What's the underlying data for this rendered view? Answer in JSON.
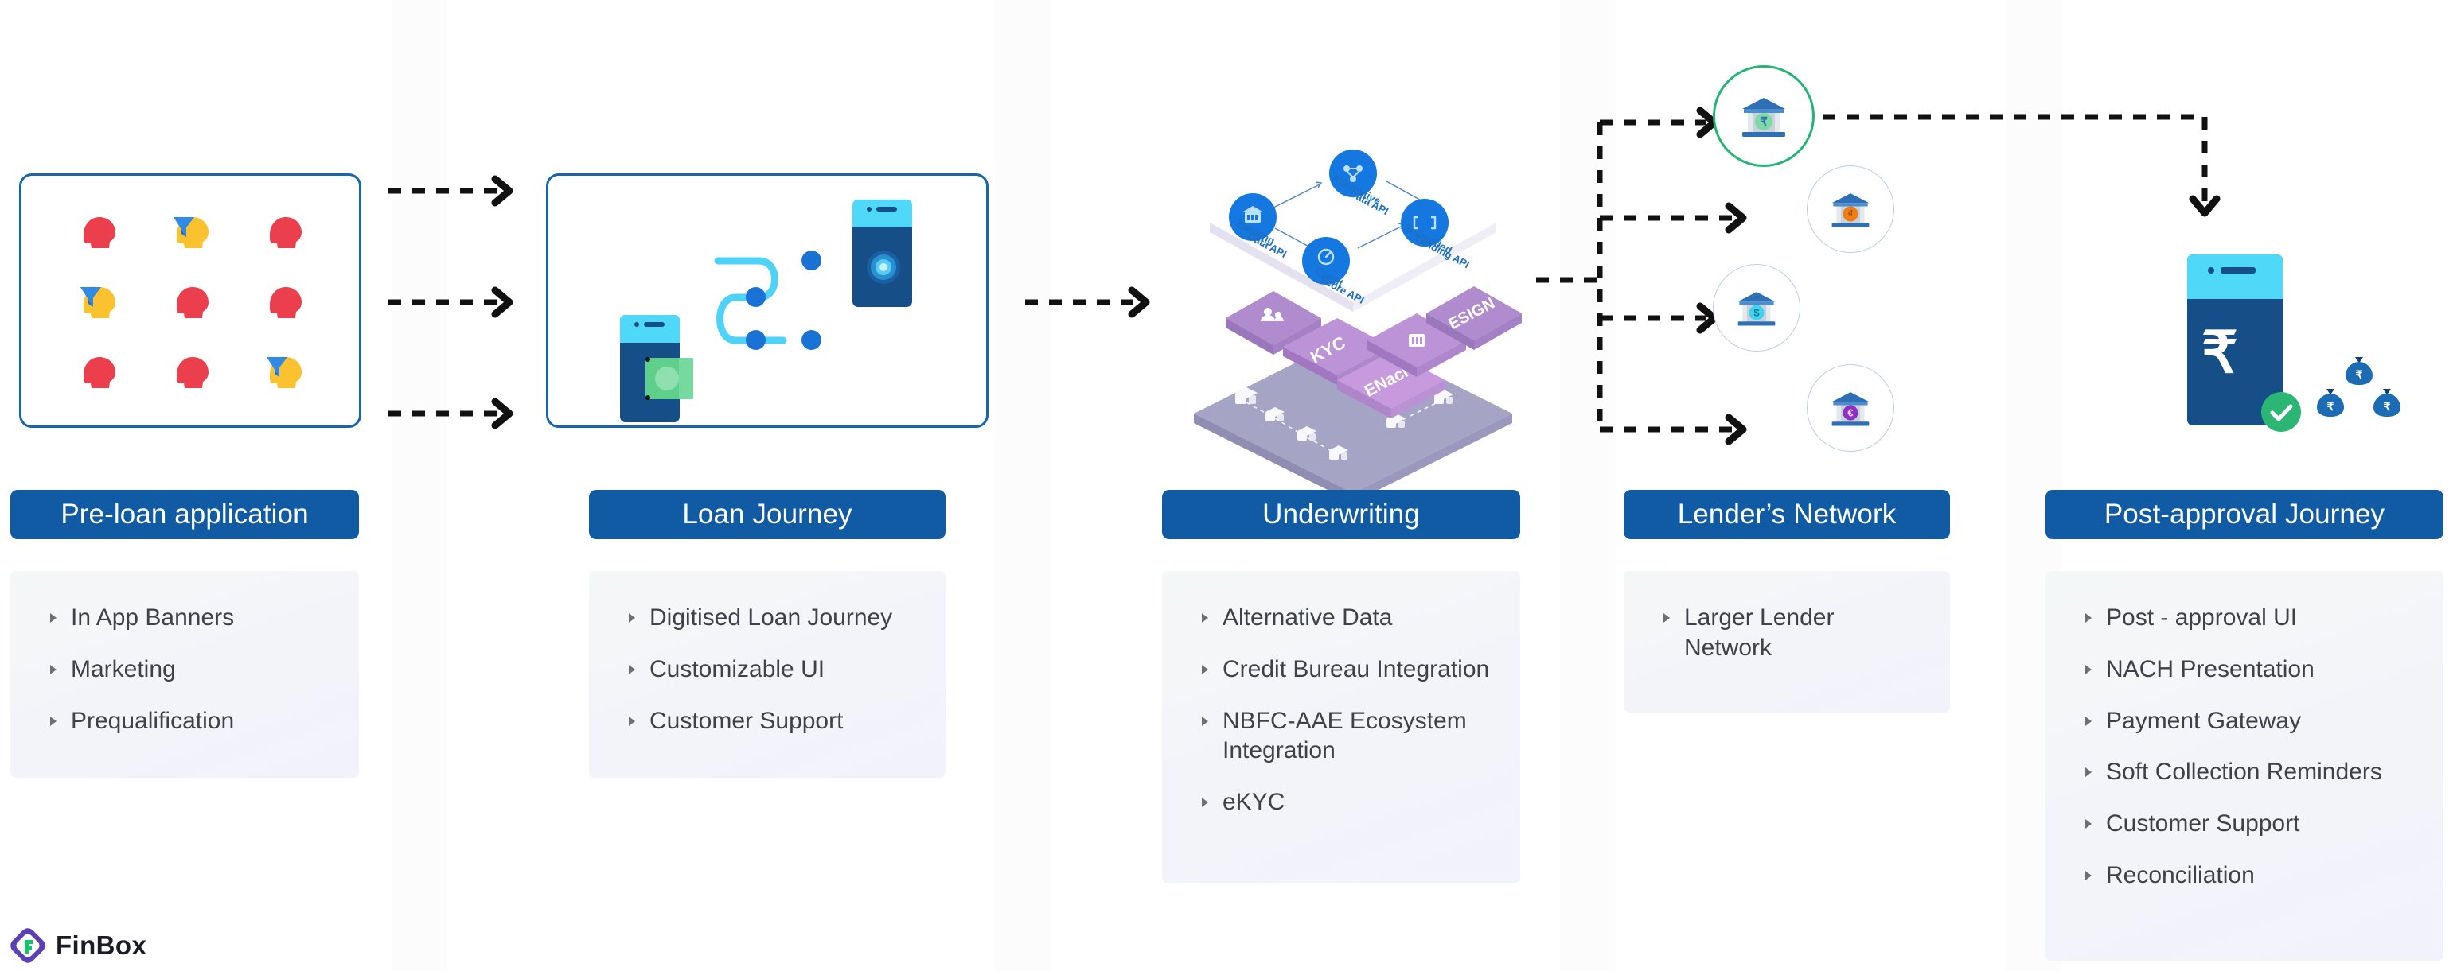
{
  "brand": {
    "name": "FinBox",
    "logo_icon": "finbox-diamond-logo-icon",
    "purple": "#5b3fb5",
    "green": "#17c26d"
  },
  "theme": {
    "pill_blue": "#105ba4",
    "frame_blue": "#1665ad",
    "panel_gradient_start": "#f4f7f7",
    "panel_gradient_end": "#f2f2fb",
    "bullet_gray": "#6b7076",
    "text_gray": "#3e4248",
    "highlight_green": "#22b573",
    "connector_black": "#111111"
  },
  "stages": [
    {
      "id": "pre-loan-application",
      "title": "Pre-loan application",
      "features": [
        "In App Banners",
        "Marketing",
        "Prequalification"
      ],
      "illustration": {
        "name": "customer-segmentation-heads-illustration",
        "description": "3 by 3 grid of side-profile head silhouettes; three of them are yellow with a blue funnel filter icon, the rest are red",
        "grid_rows": 3,
        "grid_cols": 3,
        "head_red": "#ec3f4e",
        "head_yellow": "#f9c22e",
        "funnel_blue": "#1a73d4",
        "funnel_positions": [
          "r1c2",
          "r2c1",
          "r3c3"
        ]
      }
    },
    {
      "id": "loan-journey",
      "title": "Loan Journey",
      "features": [
        "Digitised Loan Journey",
        "Customizable UI",
        "Customer Support"
      ],
      "illustration": {
        "name": "digital-loan-journey-illustration",
        "description": "Two smartphones connected by a light-blue S shaped path with four round nodes; the left phone shows a green money card, the right phone shows a glowing blue fingerprint target",
        "phone_body": "#164e87",
        "phone_top": "#4fd8f7",
        "path_blue": "#4ed2f7",
        "node_blue": "#1a73d4",
        "card_green": "#5ed08b",
        "node_count": 4
      }
    },
    {
      "id": "underwriting",
      "title": "Underwriting",
      "features": [
        "Alternative Data",
        "Credit Bureau Integration",
        "NBFC-AAE Ecosystem Integration",
        "eKYC"
      ],
      "illustration": {
        "name": "isometric-api-stack-illustration",
        "description": "Three stacked isometric layers: a white top plate with four blue circular API nodes joined by arrows, a purple middle layer of service tiles, and a grey-violet base layer of document icons",
        "top_layer_nodes": [
          {
            "label": "Banking Data API",
            "icon": "bank-icon"
          },
          {
            "label": "Alternative Data API",
            "icon": "share-nodes-icon"
          },
          {
            "label": "Embedded Lending API",
            "icon": "code-brackets-icon"
          },
          {
            "label": "Credit Score API",
            "icon": "gauge-icon"
          }
        ],
        "middle_layer_tiles": [
          "KYC",
          "ENach",
          "ESIGN"
        ],
        "middle_layer_icon_tiles": [
          "users-icon",
          "bank-icon"
        ],
        "node_blue": "#1577e0",
        "purple_tile": "#b08ccf",
        "base_layer": "#a6a4c4"
      }
    },
    {
      "id": "lenders-network",
      "title": "Lender’s Network",
      "features": [
        "Larger Lender Network"
      ],
      "illustration": {
        "name": "lender-bank-network-illustration",
        "description": "Four circular bank icons fed by a dashed branching connector; the top bank is ringed in green to show the selected lender",
        "banks": [
          {
            "currency": "₹",
            "coin_color": "#7ed9a6",
            "ring": "highlight"
          },
          {
            "currency": "₫",
            "coin_color": "#f07c18",
            "ring": "plain"
          },
          {
            "currency": "$",
            "coin_color": "#3fd3f0",
            "ring": "plain"
          },
          {
            "currency": "€",
            "coin_color": "#8e2fc4",
            "ring": "plain"
          }
        ]
      }
    },
    {
      "id": "post-approval-journey",
      "title": "Post-approval Journey",
      "features": [
        "Post - approval UI",
        "NACH Presentation",
        "Payment Gateway",
        "Soft Collection Reminders",
        "Customer Support",
        "Reconciliation"
      ],
      "illustration": {
        "name": "disbursal-success-illustration",
        "description": "A smartphone displaying a white rupee symbol with a green check badge at its corner, beside three blue money bags marked with rupee symbols",
        "phone_body": "#164e87",
        "phone_top": "#4fd8f7",
        "currency_symbol": "₹",
        "check_badge_color": "#2bb673",
        "bag_color": "#1c6cb5",
        "bag_count": 3
      }
    }
  ],
  "connectors": {
    "pre_to_loan": {
      "name": "dashed-arrows-pre-to-loan",
      "count": 3,
      "style": "dashed",
      "head": "chevron"
    },
    "loan_to_underwriting": {
      "name": "dashed-arrow-loan-to-underwriting",
      "count": 1,
      "style": "dashed",
      "head": "chevron"
    },
    "underwriting_to_lenders": {
      "name": "dashed-branch-underwriting-to-lenders",
      "branches": 4,
      "style": "dashed",
      "head": "chevron"
    },
    "lender_to_post_approval": {
      "name": "dashed-return-path-lender-to-post-approval",
      "style": "dashed",
      "head": "chevron-down"
    }
  }
}
